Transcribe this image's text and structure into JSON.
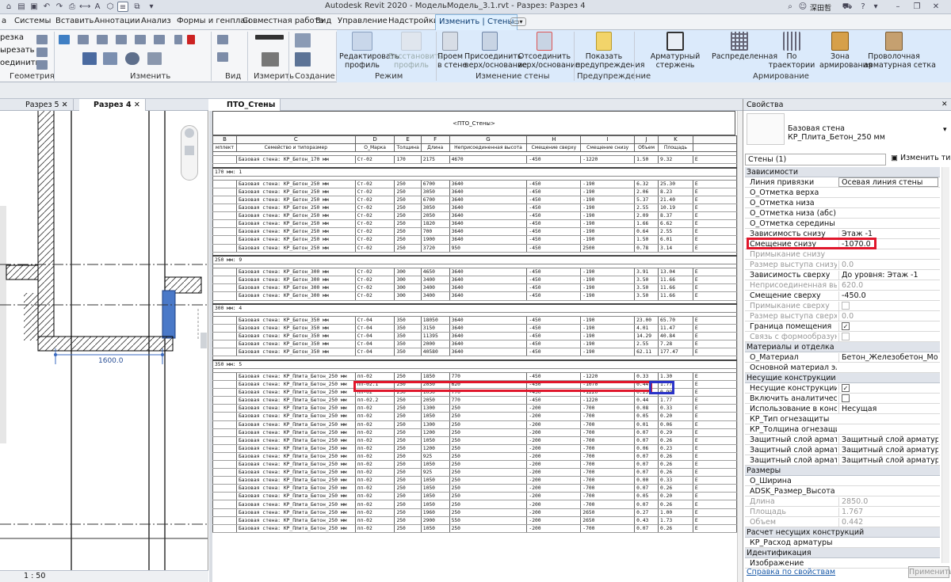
{
  "app": {
    "title": "Autodesk Revit 2020 - МодельМодель_3.1.rvt - Разрез: Разрез 4",
    "user": "深田哲"
  },
  "menu": [
    "а",
    "Системы",
    "Вставить",
    "Аннотации",
    "Анализ",
    "Формы и генплан",
    "Совместная работа",
    "Вид",
    "Управление",
    "Надстройки",
    "Изменить | Стены"
  ],
  "ribbon": {
    "left_labels": [
      "резка",
      "ырезать",
      "оединить"
    ],
    "groups": [
      "Геометрия",
      "Изменить",
      "Вид",
      "Измерить",
      "Создание",
      "Режим",
      "Изменение стены",
      "Предупреждение",
      "Армирование"
    ],
    "buttons": {
      "edit_profile": "Редактировать\nпрофиль",
      "restore_profile": "Восстановить\nпрофиль",
      "opening": "Проем\nв стене",
      "attach": "Присоединить\nверх/основание",
      "detach": "Отсоединить\nверх/основание",
      "warnings": "Показать\nпредупреждения",
      "rebar": "Арматурный стержень",
      "distributed": "Распределенная",
      "path": "По траектории",
      "area": "Зона\nармирования",
      "mesh": "Проволочная\nарматурная сетка"
    }
  },
  "tabs": {
    "left": [
      {
        "label": "Разрез 5"
      },
      {
        "label": "Разрез 4"
      }
    ],
    "schedule": "ПТО_Стены"
  },
  "left_view": {
    "dimension": "1600.0",
    "scale": "1 : 50"
  },
  "schedule": {
    "title": "<ПТО_Стены>",
    "col_letters": [
      "B",
      "C",
      "D",
      "E",
      "F",
      "G",
      "H",
      "I",
      "J",
      "K",
      ""
    ],
    "col_headers": [
      "мплект",
      "Семейство и типоразмер",
      "О_Марка",
      "Толщина",
      "Длина",
      "Неприсоединенная высота",
      "Смещение сверху",
      "Смещение снизу",
      "Объем",
      "Площадь",
      ""
    ],
    "rows": [
      {
        "t": "s"
      },
      {
        "t": "d",
        "c": [
          "",
          "Базовая стена: КР_Бетон_170 мм",
          "Ст-02",
          "170",
          "2175",
          "4670",
          "-450",
          "-1220",
          "1.50",
          "9.32",
          "Е"
        ]
      },
      {
        "t": "s"
      },
      {
        "t": "g",
        "label": "170 мм: 1"
      },
      {
        "t": "s"
      },
      {
        "t": "d",
        "c": [
          "",
          "Базовая стена: КР_Бетон_250 мм",
          "Ст-02",
          "250",
          "6700",
          "3640",
          "-450",
          "-190",
          "6.32",
          "25.30",
          "Е"
        ]
      },
      {
        "t": "d",
        "c": [
          "",
          "Базовая стена: КР_Бетон_250 мм",
          "Ст-02",
          "250",
          "3050",
          "3640",
          "-450",
          "-190",
          "2.06",
          "8.23",
          "Е"
        ]
      },
      {
        "t": "d",
        "c": [
          "",
          "Базовая стена: КР_Бетон_250 мм",
          "Ст-02",
          "250",
          "6700",
          "3640",
          "-450",
          "-190",
          "5.37",
          "21.40",
          "Е"
        ]
      },
      {
        "t": "d",
        "c": [
          "",
          "Базовая стена: КР_Бетон_250 мм",
          "Ст-02",
          "250",
          "3050",
          "3640",
          "-450",
          "-190",
          "2.55",
          "10.19",
          "Е"
        ]
      },
      {
        "t": "d",
        "c": [
          "",
          "Базовая стена: КР_Бетон_250 мм",
          "Ст-02",
          "250",
          "2050",
          "3640",
          "-450",
          "-190",
          "2.09",
          "8.37",
          "Е"
        ]
      },
      {
        "t": "d",
        "c": [
          "",
          "Базовая стена: КР_Бетон_250 мм",
          "Ст-02",
          "250",
          "1820",
          "3640",
          "-450",
          "-190",
          "1.66",
          "6.62",
          "Е"
        ]
      },
      {
        "t": "d",
        "c": [
          "",
          "Базовая стена: КР_Бетон_250 мм",
          "Ст-02",
          "250",
          "700",
          "3640",
          "-450",
          "-190",
          "0.64",
          "2.55",
          "Е"
        ]
      },
      {
        "t": "d",
        "c": [
          "",
          "Базовая стена: КР_Бетон_250 мм",
          "Ст-02",
          "250",
          "1900",
          "3640",
          "-450",
          "-190",
          "1.50",
          "6.01",
          "Е"
        ]
      },
      {
        "t": "d",
        "c": [
          "",
          "Базовая стена: КР_Бетон_250 мм",
          "Ст-02",
          "250",
          "3720",
          "950",
          "-450",
          "2500",
          "0.78",
          "3.14",
          "Е"
        ]
      },
      {
        "t": "s"
      },
      {
        "t": "g",
        "label": "250 мм: 9"
      },
      {
        "t": "s"
      },
      {
        "t": "d",
        "c": [
          "",
          "Базовая стена: КР_Бетон_300 мм",
          "Ст-02",
          "300",
          "4650",
          "3640",
          "-450",
          "-190",
          "3.91",
          "13.04",
          "Е"
        ]
      },
      {
        "t": "d",
        "c": [
          "",
          "Базовая стена: КР_Бетон_300 мм",
          "Ст-02",
          "300",
          "3400",
          "3640",
          "-450",
          "-190",
          "3.50",
          "11.66",
          "Е"
        ]
      },
      {
        "t": "d",
        "c": [
          "",
          "Базовая стена: КР_Бетон_300 мм",
          "Ст-02",
          "300",
          "3400",
          "3640",
          "-450",
          "-190",
          "3.50",
          "11.66",
          "Е"
        ]
      },
      {
        "t": "d",
        "c": [
          "",
          "Базовая стена: КР_Бетон_300 мм",
          "Ст-02",
          "300",
          "3400",
          "3640",
          "-450",
          "-190",
          "3.50",
          "11.66",
          "Е"
        ]
      },
      {
        "t": "s"
      },
      {
        "t": "g",
        "label": "300 мм: 4"
      },
      {
        "t": "s"
      },
      {
        "t": "d",
        "c": [
          "",
          "Базовая стена: КР_Бетон_350 мм",
          "Ст-04",
          "350",
          "18050",
          "3640",
          "-450",
          "-190",
          "23.00",
          "65.70",
          "Е"
        ]
      },
      {
        "t": "d",
        "c": [
          "",
          "Базовая стена: КР_Бетон_350 мм",
          "Ст-04",
          "350",
          "3150",
          "3640",
          "-450",
          "-190",
          "4.01",
          "11.47",
          "Е"
        ]
      },
      {
        "t": "d",
        "c": [
          "",
          "Базовая стена: КР_Бетон_350 мм",
          "Ст-04",
          "350",
          "11395",
          "3640",
          "-450",
          "-190",
          "14.29",
          "40.84",
          "Е"
        ]
      },
      {
        "t": "d",
        "c": [
          "",
          "Базовая стена: КР_Бетон_350 мм",
          "Ст-04",
          "350",
          "2000",
          "3640",
          "-450",
          "-190",
          "2.55",
          "7.28",
          "Е"
        ]
      },
      {
        "t": "d",
        "c": [
          "",
          "Базовая стена: КР_Бетон_350 мм",
          "Ст-04",
          "350",
          "40580",
          "3640",
          "-450",
          "-190",
          "62.11",
          "177.47",
          "Е"
        ]
      },
      {
        "t": "s"
      },
      {
        "t": "g",
        "label": "350 мм: 5"
      },
      {
        "t": "s"
      },
      {
        "t": "d",
        "c": [
          "",
          "Базовая стена: КР_Плита_Бетон_250 мм",
          "пп-02",
          "250",
          "1850",
          "770",
          "-450",
          "-1220",
          "0.33",
          "1.30",
          "Е"
        ]
      },
      {
        "t": "d",
        "c": [
          "",
          "Базовая стена: КР_Плита_Бетон_250 мм",
          "пп-02.1",
          "250",
          "2050",
          "620",
          "-450",
          "-1070",
          "0.44",
          "1.77",
          "Е"
        ]
      },
      {
        "t": "d",
        "c": [
          "",
          "Базовая стена: КР_Плита_Бетон_250 мм",
          "пп-02",
          "250",
          "1050",
          "770",
          "-450",
          "-1220",
          "0.25",
          "0.99",
          "Е"
        ]
      },
      {
        "t": "d",
        "c": [
          "",
          "Базовая стена: КР_Плита_Бетон_250 мм",
          "пп-02.2",
          "250",
          "2050",
          "770",
          "-450",
          "-1220",
          "0.44",
          "1.77",
          "Е"
        ]
      },
      {
        "t": "d",
        "c": [
          "",
          "Базовая стена: КР_Плита_Бетон_250 мм",
          "пп-02",
          "250",
          "1300",
          "250",
          "-200",
          "-700",
          "0.08",
          "0.33",
          "Е"
        ]
      },
      {
        "t": "d",
        "c": [
          "",
          "Базовая стена: КР_Плита_Бетон_250 мм",
          "пп-02",
          "250",
          "1050",
          "250",
          "-200",
          "-700",
          "0.05",
          "0.20",
          "Е"
        ]
      },
      {
        "t": "d",
        "c": [
          "",
          "Базовая стена: КР_Плита_Бетон_250 мм",
          "пп-02",
          "250",
          "1300",
          "250",
          "-200",
          "-700",
          "0.01",
          "0.06",
          "Е"
        ]
      },
      {
        "t": "d",
        "c": [
          "",
          "Базовая стена: КР_Плита_Бетон_250 мм",
          "пп-02",
          "250",
          "1200",
          "250",
          "-200",
          "-700",
          "0.07",
          "0.29",
          "Е"
        ]
      },
      {
        "t": "d",
        "c": [
          "",
          "Базовая стена: КР_Плита_Бетон_250 мм",
          "пп-02",
          "250",
          "1050",
          "250",
          "-200",
          "-700",
          "0.07",
          "0.26",
          "Е"
        ]
      },
      {
        "t": "d",
        "c": [
          "",
          "Базовая стена: КР_Плита_Бетон_250 мм",
          "пп-02",
          "250",
          "1200",
          "250",
          "-200",
          "-700",
          "0.06",
          "0.23",
          "Е"
        ]
      },
      {
        "t": "d",
        "c": [
          "",
          "Базовая стена: КР_Плита_Бетон_250 мм",
          "пп-02",
          "250",
          "925",
          "250",
          "-200",
          "-700",
          "0.07",
          "0.26",
          "Е"
        ]
      },
      {
        "t": "d",
        "c": [
          "",
          "Базовая стена: КР_Плита_Бетон_250 мм",
          "пп-02",
          "250",
          "1050",
          "250",
          "-200",
          "-700",
          "0.07",
          "0.26",
          "Е"
        ]
      },
      {
        "t": "d",
        "c": [
          "",
          "Базовая стена: КР_Плита_Бетон_250 мм",
          "пп-02",
          "250",
          "925",
          "250",
          "-200",
          "-700",
          "0.07",
          "0.26",
          "Е"
        ]
      },
      {
        "t": "d",
        "c": [
          "",
          "Базовая стена: КР_Плита_Бетон_250 мм",
          "пп-02",
          "250",
          "1050",
          "250",
          "-200",
          "-700",
          "0.00",
          "0.33",
          "Е"
        ]
      },
      {
        "t": "d",
        "c": [
          "",
          "Базовая стена: КР_Плита_Бетон_250 мм",
          "пп-02",
          "250",
          "1050",
          "250",
          "-200",
          "-700",
          "0.07",
          "0.26",
          "Е"
        ]
      },
      {
        "t": "d",
        "c": [
          "",
          "Базовая стена: КР_Плита_Бетон_250 мм",
          "пп-02",
          "250",
          "1050",
          "250",
          "-200",
          "-700",
          "0.05",
          "0.20",
          "Е"
        ]
      },
      {
        "t": "d",
        "c": [
          "",
          "Базовая стена: КР_Плита_Бетон_250 мм",
          "пп-02",
          "250",
          "1050",
          "250",
          "-200",
          "-700",
          "0.07",
          "0.26",
          "Е"
        ]
      },
      {
        "t": "d",
        "c": [
          "",
          "Базовая стена: КР_Плита_Бетон_250 мм",
          "пп-02",
          "250",
          "1960",
          "250",
          "-200",
          "2650",
          "0.27",
          "1.00",
          "Е"
        ]
      },
      {
        "t": "d",
        "c": [
          "",
          "Базовая стена: КР_Плита_Бетон_250 мм",
          "пп-02",
          "250",
          "2900",
          "550",
          "-200",
          "2650",
          "0.43",
          "1.73",
          "Е"
        ]
      },
      {
        "t": "d",
        "c": [
          "",
          "Базовая стена: КР_Плита_Бетон_250 мм",
          "пп-02",
          "250",
          "1050",
          "250",
          "-200",
          "-700",
          "0.07",
          "0.26",
          "Е"
        ]
      }
    ]
  },
  "properties": {
    "title": "Свойства",
    "type_name": "Базовая стена\nКР_Плита_Бетон_250 мм",
    "selection": "Стены (1)",
    "edit_type": "Изменить тип",
    "rows": [
      {
        "cat": "Зависимости"
      },
      {
        "l": "Линия привязки",
        "v": "Осевая линия стены",
        "box": true
      },
      {
        "l": "О_Отметка верха",
        "v": ""
      },
      {
        "l": "О_Отметка низа",
        "v": ""
      },
      {
        "l": "О_Отметка низа (абс)",
        "v": ""
      },
      {
        "l": "О_Отметка середины",
        "v": ""
      },
      {
        "l": "Зависимость снизу",
        "v": "Этаж -1"
      },
      {
        "l": "Смещение снизу",
        "v": "-1070.0",
        "red": true
      },
      {
        "l": "Примыкание снизу",
        "v": "",
        "dim": true
      },
      {
        "l": "Размер выступа снизу",
        "v": "0.0",
        "dim": true
      },
      {
        "l": "Зависимость сверху",
        "v": "До уровня: Этаж -1"
      },
      {
        "l": "Неприсоединенная высота",
        "v": "620.0",
        "dim": true
      },
      {
        "l": "Смещение сверху",
        "v": "-450.0"
      },
      {
        "l": "Примыкание сверху",
        "v": "",
        "chk": "off",
        "dim": true
      },
      {
        "l": "Размер выступа сверху",
        "v": "0.0",
        "dim": true
      },
      {
        "l": "Граница помещения",
        "v": "✓",
        "chk": "on"
      },
      {
        "l": "Связь с формообразующ...",
        "v": "",
        "chk": "off",
        "dim": true
      },
      {
        "cat": "Материалы и отделка"
      },
      {
        "l": "О_Материал",
        "v": "Бетон_Железобетон_Мо..."
      },
      {
        "l": "Основной материал элем...",
        "v": ""
      },
      {
        "cat": "Несущие конструкции"
      },
      {
        "l": "Несущие конструкции",
        "v": "✓",
        "chk": "on"
      },
      {
        "l": "Включить аналитическ...",
        "v": "",
        "chk": "off"
      },
      {
        "l": "Использование в констру...",
        "v": "Несущая"
      },
      {
        "l": "КР_Тип огнезащиты",
        "v": ""
      },
      {
        "l": "КР_Толщина огнезащиты",
        "v": ""
      },
      {
        "l": "Защитный слой арматур...",
        "v": "Защитный слой арматуры..."
      },
      {
        "l": "Защитный слой арматур...",
        "v": "Защитный слой арматуры..."
      },
      {
        "l": "Защитный слой арматур...",
        "v": "Защитный слой арматуры..."
      },
      {
        "cat": "Размеры"
      },
      {
        "l": "О_Ширина",
        "v": ""
      },
      {
        "l": "ADSK_Размер_Высота",
        "v": ""
      },
      {
        "l": "Длина",
        "v": "2850.0",
        "dim": true
      },
      {
        "l": "Площадь",
        "v": "1.767",
        "dim": true
      },
      {
        "l": "Объем",
        "v": "0.442",
        "dim": true
      },
      {
        "cat": "Расчет несущих конструкций"
      },
      {
        "l": "КР_Расход арматуры",
        "v": ""
      },
      {
        "cat": "Идентификация"
      },
      {
        "l": "Изображение",
        "v": ""
      }
    ],
    "help": "Справка по свойствам",
    "apply": "Применить"
  },
  "colors": {
    "highlight_red": "#e0162b",
    "highlight_blue": "#2a33c8",
    "ribbon_active": "#dbeafb"
  }
}
